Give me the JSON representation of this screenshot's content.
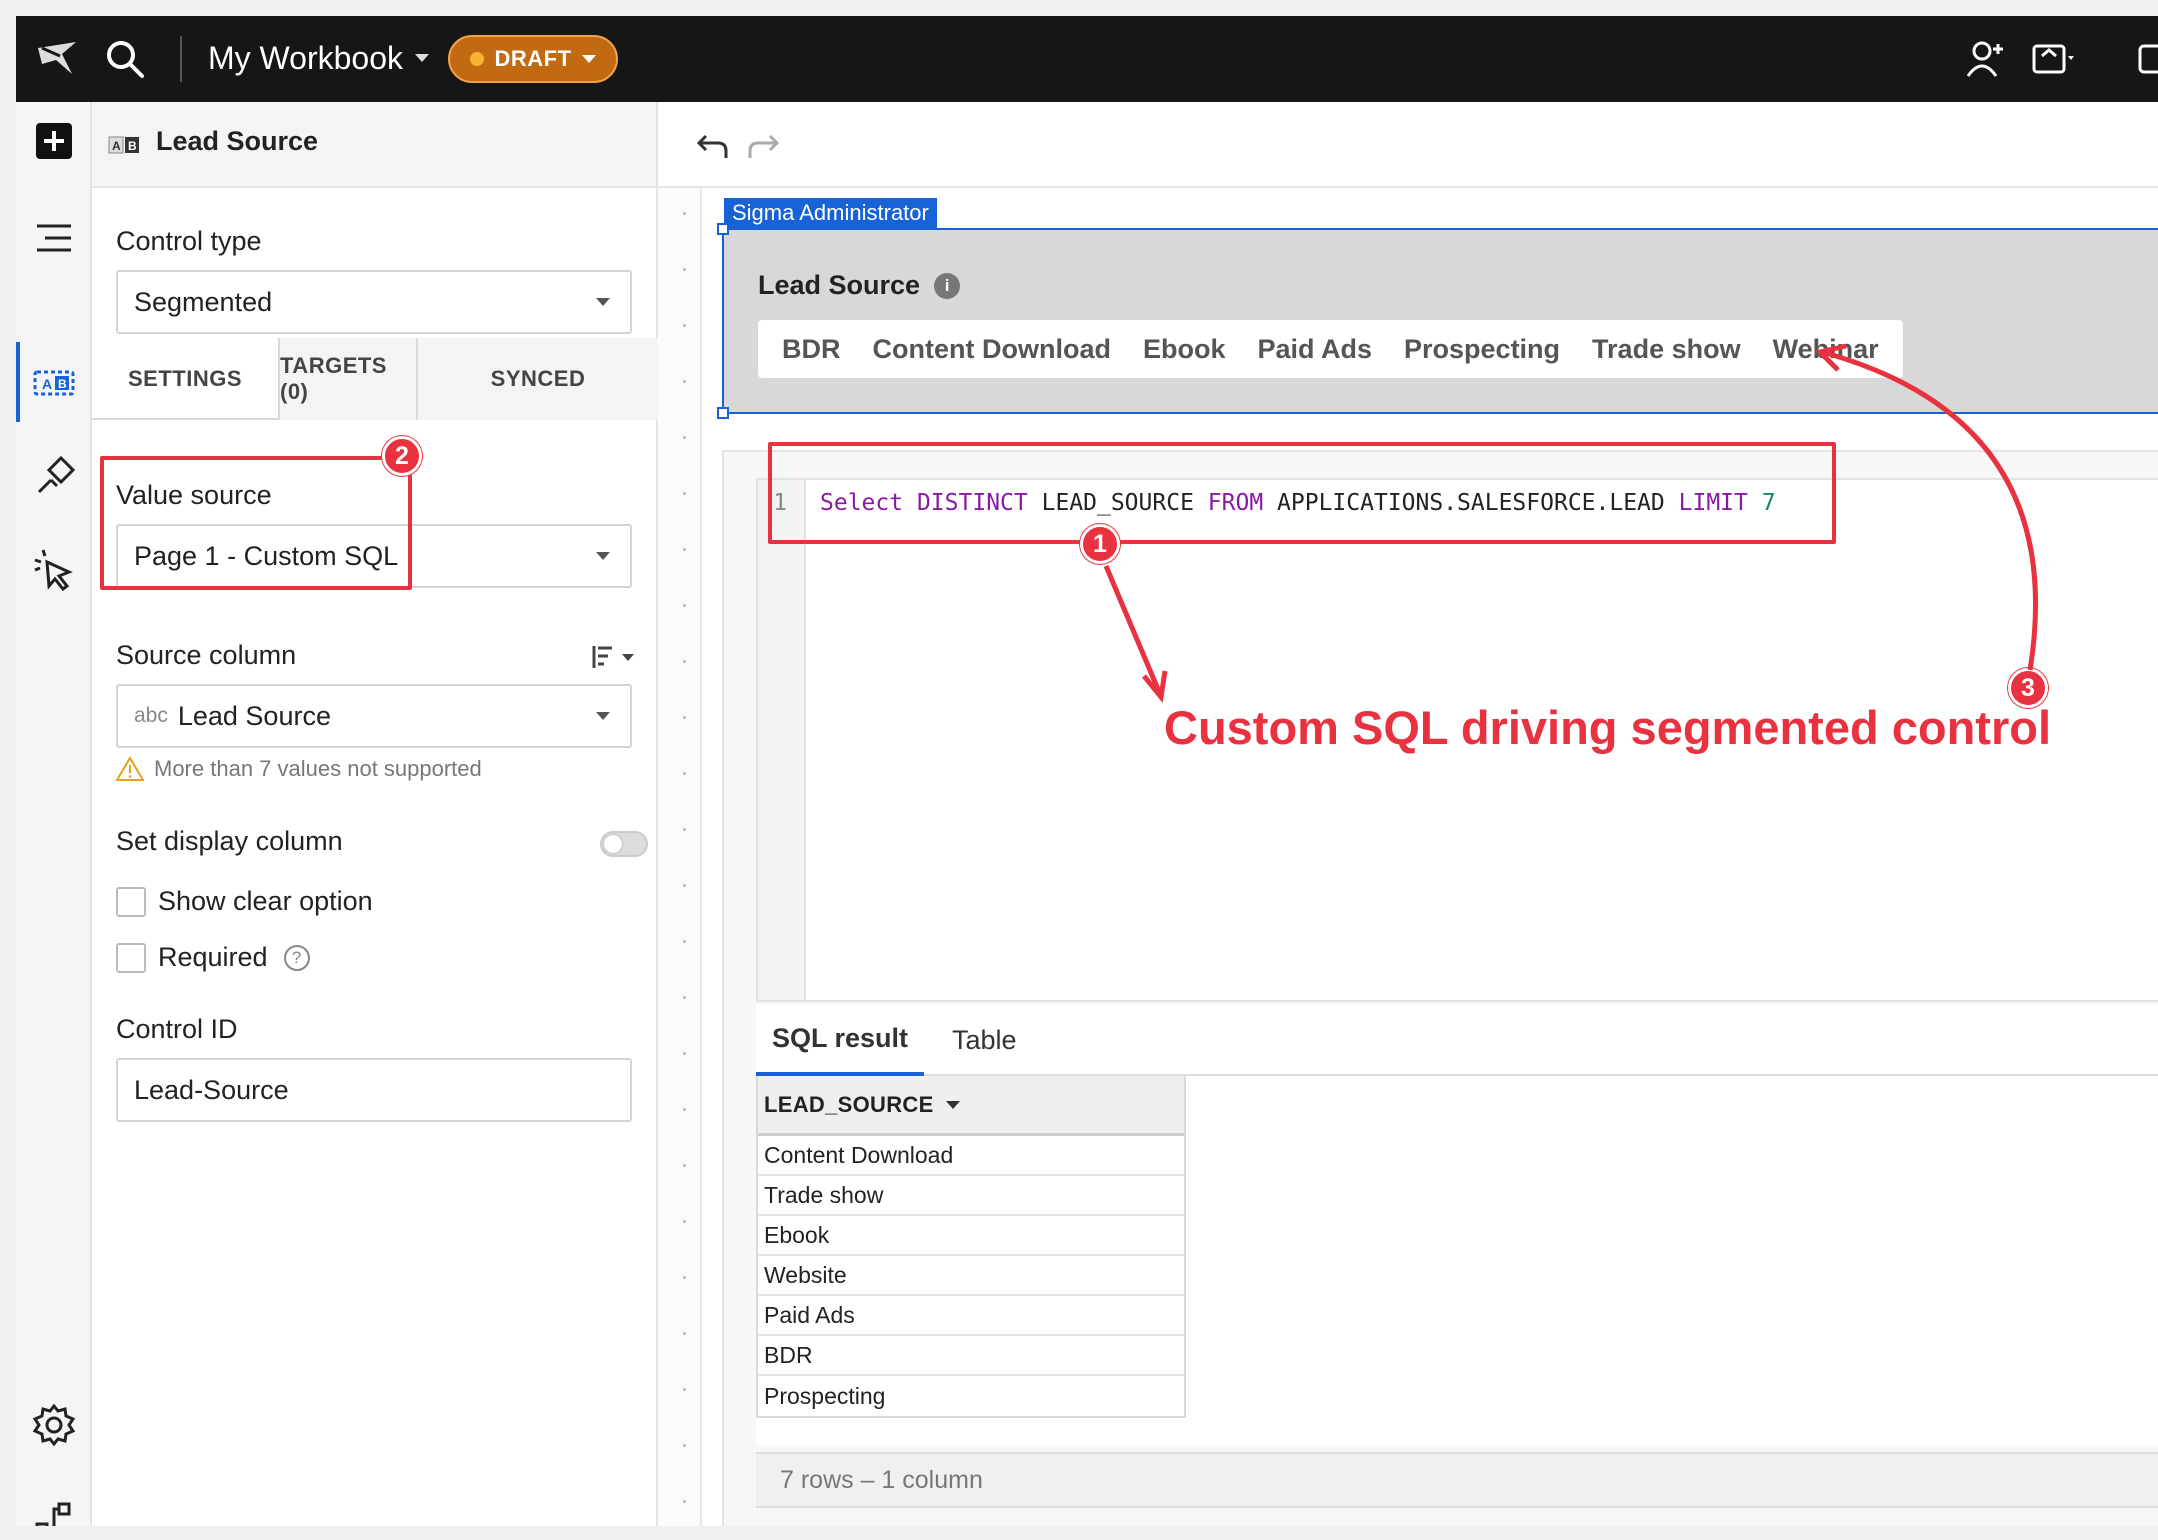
{
  "topbar": {
    "workbook_title": "My Workbook",
    "status_badge": "DRAFT"
  },
  "panel": {
    "title": "Lead Source",
    "control_type_label": "Control type",
    "control_type_value": "Segmented",
    "tabs": [
      "SETTINGS",
      "TARGETS (0)",
      "SYNCED"
    ],
    "value_source_label": "Value source",
    "value_source_value": "Page 1 - Custom SQL",
    "source_column_label": "Source column",
    "source_column_type": "abc",
    "source_column_value": "Lead Source",
    "warning_text": "More than 7 values not supported",
    "display_column_label": "Set display column",
    "show_clear_label": "Show clear option",
    "required_label": "Required",
    "control_id_label": "Control ID",
    "control_id_value": "Lead-Source"
  },
  "canvas": {
    "admin_tag": "Sigma Administrator",
    "control_title": "Lead Source",
    "segments": [
      "BDR",
      "Content Download",
      "Ebook",
      "Paid Ads",
      "Prospecting",
      "Trade show",
      "Webinar"
    ],
    "sql": {
      "line_number": "1",
      "kw_select": "Select",
      "kw_distinct": "DISTINCT",
      "column": "LEAD_SOURCE",
      "kw_from": "FROM",
      "table": "APPLICATIONS.SALESFORCE.LEAD",
      "kw_limit": "LIMIT",
      "limit_value": "7"
    },
    "result_tabs": [
      "SQL result",
      "Table"
    ],
    "result_column": "LEAD_SOURCE",
    "result_rows": [
      "Content Download",
      "Trade show",
      "Ebook",
      "Website",
      "Paid Ads",
      "BDR",
      "Prospecting"
    ],
    "result_footer": "7 rows – 1 column"
  },
  "annotations": {
    "badge_1": "1",
    "badge_2": "2",
    "badge_3": "3",
    "caption": "Custom SQL driving segmented control",
    "color": "#e8323f"
  },
  "icons": {
    "topbar": [
      "sigma-logo-icon",
      "search-icon",
      "add-user-icon",
      "sync-icon",
      "more-icon"
    ],
    "rail": [
      "plus-icon",
      "outline-icon",
      "control-element-icon",
      "format-icon",
      "interaction-icon",
      "settings-gear-icon",
      "hierarchy-icon"
    ]
  },
  "colors": {
    "topbar_bg": "#161616",
    "draft_badge": "#c26a12",
    "accent_blue": "#1762d6",
    "sql_keyword": "#8a1aa5",
    "sql_number": "#138a5a"
  }
}
